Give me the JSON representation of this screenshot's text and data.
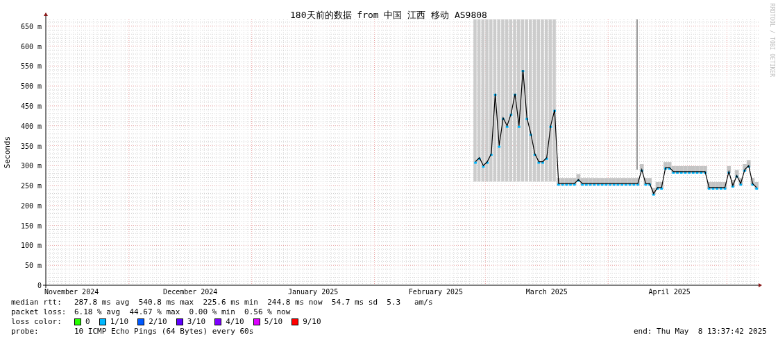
{
  "chart": {
    "chart_data": {
      "type": "line",
      "title": "180天前的数据 from 中国 江西 移动 AS9808",
      "ylabel": "Seconds",
      "categories": [
        null,
        null,
        null,
        null,
        null,
        null,
        "November 2024",
        null,
        null,
        null,
        null,
        null,
        null,
        null,
        null,
        null,
        null,
        null,
        null,
        null,
        null,
        null,
        null,
        null,
        null,
        null,
        null,
        null,
        null,
        null,
        null,
        null,
        null,
        null,
        null,
        null,
        "December 2024",
        null,
        null,
        null,
        null,
        null,
        null,
        null,
        null,
        null,
        null,
        null,
        null,
        null,
        null,
        null,
        null,
        null,
        null,
        null,
        null,
        null,
        null,
        null,
        null,
        null,
        null,
        null,
        null,
        null,
        null,
        "January 2025",
        null,
        null,
        null,
        null,
        null,
        null,
        null,
        null,
        null,
        null,
        null,
        null,
        null,
        null,
        null,
        null,
        null,
        null,
        null,
        null,
        null,
        null,
        null,
        null,
        null,
        null,
        null,
        null,
        null,
        null,
        "February 2025",
        null,
        null,
        null,
        null,
        null,
        null,
        null,
        null,
        null,
        null,
        null,
        null,
        null,
        null,
        null,
        null,
        null,
        null,
        null,
        null,
        null,
        null,
        null,
        null,
        null,
        null,
        null,
        "March 2025",
        null,
        null,
        null,
        null,
        null,
        null,
        null,
        null,
        null,
        null,
        null,
        null,
        null,
        null,
        null,
        null,
        null,
        null,
        null,
        null,
        null,
        null,
        null,
        null,
        null,
        null,
        null,
        null,
        null,
        null,
        "April 2025",
        null,
        null,
        null,
        null,
        null,
        null,
        null,
        null,
        null,
        null,
        null,
        null,
        null,
        null,
        null,
        null,
        null,
        null,
        null,
        null,
        null,
        null
      ],
      "series": [
        {
          "color": "#000000",
          "marker": "square",
          "values": [
            null,
            null,
            null,
            null,
            null,
            null,
            null,
            null,
            null,
            null,
            null,
            null,
            null,
            null,
            null,
            null,
            null,
            null,
            null,
            null,
            null,
            null,
            null,
            null,
            null,
            null,
            null,
            null,
            null,
            null,
            null,
            null,
            null,
            null,
            null,
            null,
            null,
            null,
            null,
            null,
            null,
            null,
            null,
            null,
            null,
            null,
            null,
            null,
            null,
            null,
            null,
            null,
            null,
            null,
            null,
            null,
            null,
            null,
            null,
            null,
            null,
            null,
            null,
            null,
            null,
            null,
            null,
            null,
            null,
            null,
            null,
            null,
            null,
            null,
            null,
            null,
            null,
            null,
            null,
            null,
            null,
            null,
            null,
            null,
            null,
            null,
            null,
            null,
            null,
            null,
            null,
            null,
            null,
            null,
            null,
            null,
            null,
            null,
            null,
            null,
            null,
            null,
            null,
            null,
            null,
            null,
            null,
            null,
            310,
            320,
            300,
            310,
            330,
            480,
            350,
            420,
            400,
            430,
            480,
            400,
            540,
            420,
            380,
            330,
            310,
            310,
            320,
            400,
            440,
            255,
            255,
            255,
            255,
            255,
            265,
            255,
            255,
            255,
            255,
            255,
            255,
            255,
            255,
            255,
            255,
            255,
            255,
            255,
            255,
            255,
            290,
            255,
            255,
            230,
            245,
            245,
            295,
            295,
            285,
            285,
            285,
            285,
            285,
            285,
            285,
            285,
            285,
            245,
            245,
            245,
            245,
            245,
            285,
            250,
            275,
            255,
            290,
            300,
            255,
            245
          ]
        }
      ],
      "ylim": [
        0,
        667
      ],
      "grid": true,
      "yticks": [
        {
          "value": 0,
          "label": "0"
        },
        {
          "value": 50,
          "label": "50 m"
        },
        {
          "value": 100,
          "label": "100 m"
        },
        {
          "value": 150,
          "label": "150 m"
        },
        {
          "value": 200,
          "label": "200 m"
        },
        {
          "value": 250,
          "label": "250 m"
        },
        {
          "value": 300,
          "label": "300 m"
        },
        {
          "value": 350,
          "label": "350 m"
        },
        {
          "value": 400,
          "label": "400 m"
        },
        {
          "value": 450,
          "label": "450 m"
        },
        {
          "value": 500,
          "label": "500 m"
        },
        {
          "value": 550,
          "label": "550 m"
        },
        {
          "value": 600,
          "label": "600 m"
        },
        {
          "value": 650,
          "label": "650 m"
        }
      ]
    }
  },
  "credit": "RRDTOOL / TOBI OETIKER",
  "stats": [
    {
      "label": "median rtt:",
      "value": "287.8 ms avg  540.8 ms max  225.6 ms min  244.8 ms now  54.7 ms sd  5.3   am/s"
    },
    {
      "label": "packet loss:",
      "value": "6.18 % avg  44.67 % max  0.00 % min  0.56 % now"
    }
  ],
  "loss_color": {
    "label": "loss color:",
    "items": [
      {
        "label": "0",
        "color": "#26ff00"
      },
      {
        "label": "1/10",
        "color": "#00b8ff"
      },
      {
        "label": "2/10",
        "color": "#0059ff"
      },
      {
        "label": "3/10",
        "color": "#5e00ff"
      },
      {
        "label": "4/10",
        "color": "#7e00ff"
      },
      {
        "label": "5/10",
        "color": "#dd00ff"
      },
      {
        "label": "9/10",
        "color": "#ff0000"
      }
    ]
  },
  "probe": {
    "label": "probe:",
    "value": "10 ICMP Echo Pings (64 Bytes) every 60s"
  },
  "end": "end: Thu May  8 13:37:42 2025"
}
